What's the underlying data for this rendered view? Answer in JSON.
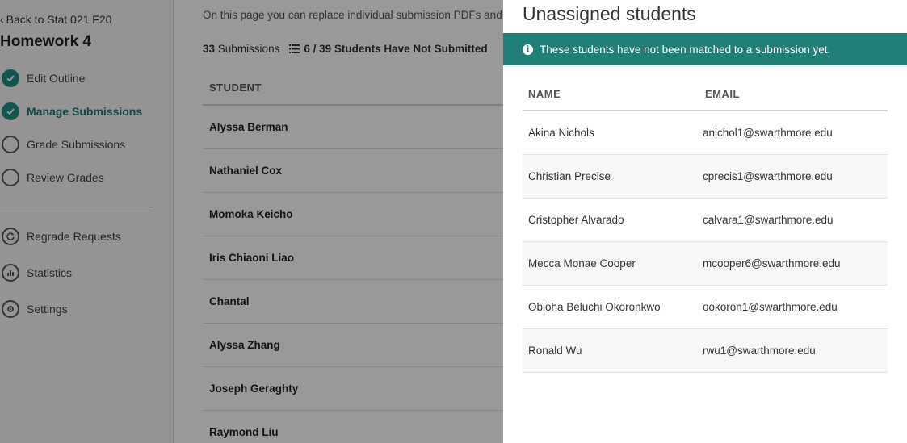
{
  "sidebar": {
    "back_label": "Back to Stat 021 F20",
    "assignment_title": "Homework 4",
    "steps": [
      {
        "label": "Edit Outline",
        "state": "done"
      },
      {
        "label": "Manage Submissions",
        "state": "done-active"
      },
      {
        "label": "Grade Submissions",
        "state": "todo"
      },
      {
        "label": "Review Grades",
        "state": "todo"
      }
    ],
    "tools": [
      {
        "label": "Regrade Requests",
        "icon": "regrade-icon"
      },
      {
        "label": "Statistics",
        "icon": "statistics-icon"
      },
      {
        "label": "Settings",
        "icon": "settings-icon"
      }
    ]
  },
  "main": {
    "intro_text": "On this page you can replace individual submission PDFs and",
    "submission_count": "33",
    "submission_label": "Submissions",
    "not_submitted_label": "6 / 39 Students Have Not Submitted",
    "student_column": "STUDENT",
    "students": [
      "Alyssa Berman",
      "Nathaniel Cox",
      "Momoka Keicho",
      "Iris Chiaoni Liao",
      "Chantal",
      "Alyssa Zhang",
      "Joseph Geraghty",
      "Raymond Liu"
    ]
  },
  "modal": {
    "title": "Unassigned students",
    "banner": "These students have not been matched to a submission yet.",
    "columns": {
      "name": "NAME",
      "email": "EMAIL"
    },
    "rows": [
      {
        "name": "Akina Nichols",
        "email": "anichol1@swarthmore.edu"
      },
      {
        "name": "Christian Precise",
        "email": "cprecis1@swarthmore.edu"
      },
      {
        "name": "Cristopher Alvarado",
        "email": "calvara1@swarthmore.edu"
      },
      {
        "name": "Mecca Monae Cooper",
        "email": "mcooper6@swarthmore.edu"
      },
      {
        "name": "Obioha Beluchi Okoronkwo",
        "email": "ookoron1@swarthmore.edu"
      },
      {
        "name": "Ronald Wu",
        "email": "rwu1@swarthmore.edu"
      }
    ]
  },
  "colors": {
    "accent": "#217f77",
    "overlay": "rgba(0,0,0,0.40)"
  }
}
